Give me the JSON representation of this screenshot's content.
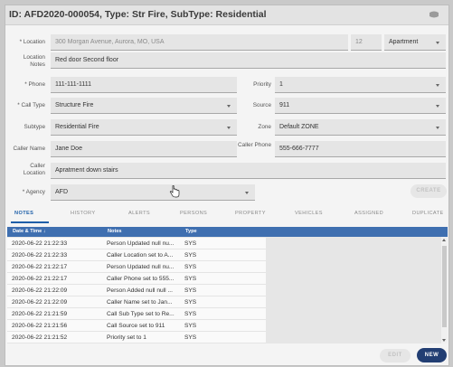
{
  "header": {
    "title": "ID: AFD2020-000054, Type: Str Fire, SubType: Residential"
  },
  "form": {
    "location_label": "* Location",
    "location_value": "300 Morgan Avenue, Aurora, MO, USA",
    "unit_value": "12",
    "unit_type": "Apartment",
    "location_notes_label": "Location Notes",
    "location_notes_value": "Red door Second floor",
    "phone_label": "* Phone",
    "phone_value": "111-111-1111",
    "priority_label": "Priority",
    "priority_value": "1",
    "call_type_label": "* Call Type",
    "call_type_value": "Structure Fire",
    "source_label": "Source",
    "source_value": "911",
    "subtype_label": "Subtype",
    "subtype_value": "Residential Fire",
    "zone_label": "Zone",
    "zone_value": "Default ZONE",
    "caller_name_label": "Caller Name",
    "caller_name_value": "Jane Doe",
    "caller_phone_label": "Caller Phone",
    "caller_phone_value": "555-666-7777",
    "caller_location_label": "Caller Location",
    "caller_location_value": "Apratment down stairs",
    "agency_label": "* Agency",
    "agency_value": "AFD",
    "create_label": "CREATE"
  },
  "tabs": [
    "NOTES",
    "HISTORY",
    "ALERTS",
    "PERSONS",
    "PROPERTY",
    "VEHICLES",
    "ASSIGNED",
    "DUPLICATE"
  ],
  "grid": {
    "headers": [
      "Date & Time ↓",
      "Notes",
      "Type"
    ],
    "rows": [
      [
        "2020-06-22 21:22:33",
        "Person Updated null nu...",
        "SYS"
      ],
      [
        "2020-06-22 21:22:33",
        "Caller Location set to A...",
        "SYS"
      ],
      [
        "2020-06-22 21:22:17",
        "Person Updated null nu...",
        "SYS"
      ],
      [
        "2020-06-22 21:22:17",
        "Caller Phone set to 555...",
        "SYS"
      ],
      [
        "2020-06-22 21:22:09",
        "Person Added null null ...",
        "SYS"
      ],
      [
        "2020-06-22 21:22:09",
        "Caller Name set to Jan...",
        "SYS"
      ],
      [
        "2020-06-22 21:21:59",
        "Call Sub Type set to Re...",
        "SYS"
      ],
      [
        "2020-06-22 21:21:56",
        "Call Source set to 911",
        "SYS"
      ],
      [
        "2020-06-22 21:21:52",
        "Priority set to 1",
        "SYS"
      ]
    ]
  },
  "footer": {
    "edit_label": "EDIT",
    "new_label": "NEW"
  }
}
